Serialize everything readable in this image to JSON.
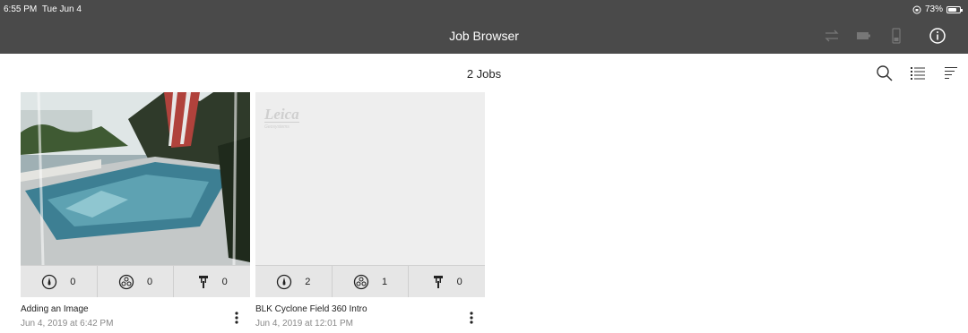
{
  "status_bar": {
    "time": "6:55 PM",
    "date": "Tue Jun 4",
    "battery": "73%",
    "battery_level": 0.73
  },
  "header": {
    "title": "Job Browser"
  },
  "toolbar": {
    "icons": [
      "sync-icon",
      "battery-icon",
      "device-icon",
      "info-icon"
    ],
    "job_count": "2 Jobs",
    "actions": [
      "search-icon",
      "list-view-icon",
      "sort-icon"
    ]
  },
  "jobs": [
    {
      "name": "Adding an Image",
      "date": "Jun 4, 2019 at 6:42 PM",
      "stats": {
        "setups": "0",
        "images": "0",
        "targets": "0"
      },
      "thumbnail": "pool-photo"
    },
    {
      "name": "BLK Cyclone Field 360 Intro",
      "date": "Jun 4, 2019 at 12:01 PM",
      "stats": {
        "setups": "2",
        "images": "1",
        "targets": "0"
      },
      "thumbnail": "leica-logo",
      "logo_text": "Leica",
      "logo_sub": "Geosystems"
    }
  ]
}
